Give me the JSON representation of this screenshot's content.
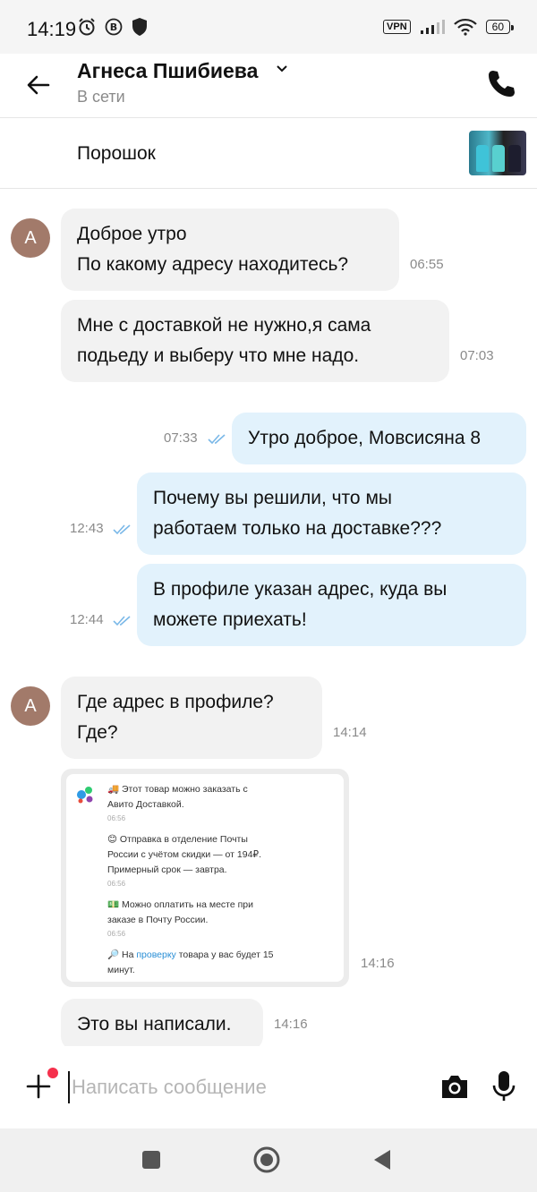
{
  "status_bar": {
    "time": "14:19",
    "vpn_label": "VPN",
    "battery": "60"
  },
  "header": {
    "contact_name": "Агнеса Пшибиева",
    "presence": "В сети"
  },
  "item": {
    "title": "Порошок"
  },
  "messages": [
    {
      "side": "in",
      "avatar": "А",
      "text": "Доброе утро\nПо какому адресу находитесь?",
      "time": "06:55"
    },
    {
      "side": "in",
      "text": "Мне с доставкой не нужно,я сама\nподьеду и выберу что мне надо.",
      "time": "07:03"
    },
    {
      "side": "out",
      "text": "Утро доброе, Мовсисяна 8",
      "time": "07:33",
      "status": "read"
    },
    {
      "side": "out",
      "text": "Почему вы решили, что мы\nработаем только на доставке???",
      "time": "12:43",
      "status": "read"
    },
    {
      "side": "out",
      "text": "В профиле указан адрес, куда вы\nможете приехать!",
      "time": "12:44",
      "status": "read"
    },
    {
      "side": "in",
      "avatar": "А",
      "text": "Где адрес в профиле?\nГде?",
      "time": "14:14"
    },
    {
      "side": "in",
      "type": "image",
      "time": "14:16"
    },
    {
      "side": "in",
      "text": "Это вы написали.",
      "time": "14:16"
    }
  ],
  "screenshot": {
    "line1a": "🚚 Этот товар можно заказать с",
    "line1b": "Авито Доставкой.",
    "t1": "06:56",
    "line2a": "😊 Отправка в отделение Почты",
    "line2b": "России с учётом скидки — от 194₽.",
    "line2c": "Примерный срок — завтра.",
    "t2": "06:56",
    "line3a": "💵 Можно оплатить на месте при",
    "line3b": "заказе в Почту России.",
    "t3": "06:56",
    "line4_pre": "🔎 На ",
    "line4_link": "проверку",
    "line4_post": " товара у вас будет 15",
    "line4b": "минут."
  },
  "composer": {
    "placeholder": "Написать сообщение"
  },
  "colors": {
    "incoming_bubble": "#f2f2f2",
    "outgoing_bubble": "#e2f2fc",
    "avatar": "#a27a6a",
    "read_tick": "#7ab8e8",
    "notification_dot": "#f5304c"
  }
}
